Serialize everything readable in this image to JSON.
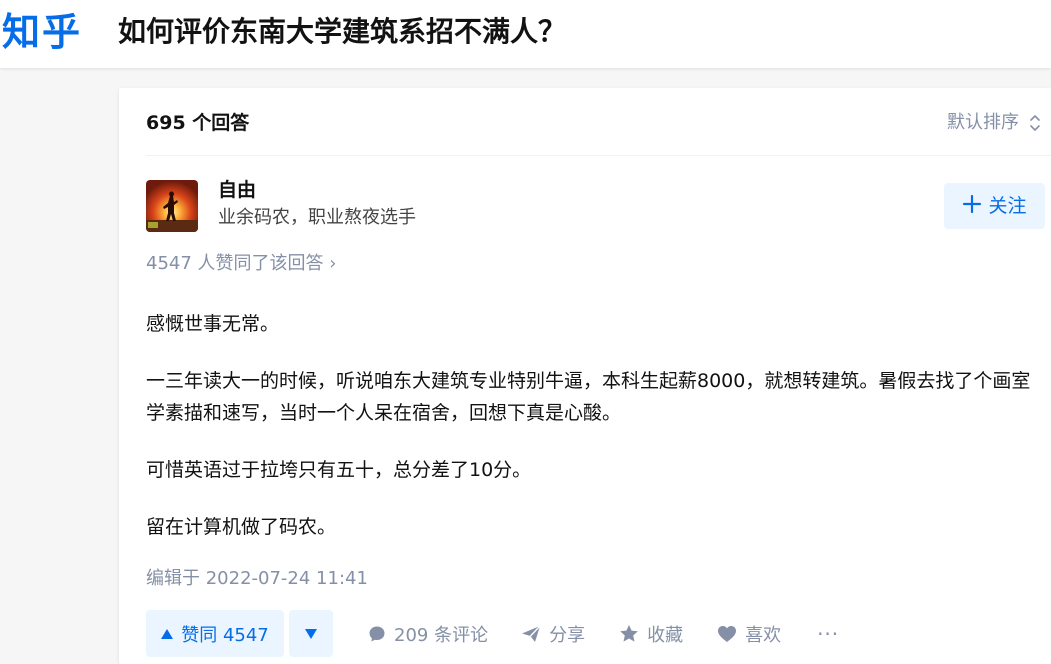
{
  "header": {
    "logo": "知乎",
    "question_title": "如何评价东南大学建筑系招不满人？"
  },
  "answers_section": {
    "count_label": "695 个回答",
    "sort_label": "默认排序"
  },
  "answer": {
    "author": {
      "name": "自由",
      "headline": "业余码农，职业熬夜选手",
      "follow_label": "关注"
    },
    "voters_label": "4547 人赞同了该回答 ›",
    "paragraphs": [
      "感慨世事无常。",
      "一三年读大一的时候，听说咱东大建筑专业特别牛逼，本科生起薪8000，就想转建筑。暑假去找了个画室学素描和速写，当时一个人呆在宿舍，回想下真是心酸。",
      "可惜英语过于拉垮只有五十，总分差了10分。",
      "留在计算机做了码农。"
    ],
    "edit_time": "编辑于 2022-07-24 11:41",
    "actions": {
      "vote_up": "赞同 4547",
      "comments": "209 条评论",
      "share": "分享",
      "collect": "收藏",
      "like": "喜欢",
      "more": "···"
    }
  },
  "colors": {
    "brand": "#056de8",
    "brand_light_bg": "#ebf5ff",
    "meta_gray": "#8590a6",
    "text": "#121212"
  }
}
